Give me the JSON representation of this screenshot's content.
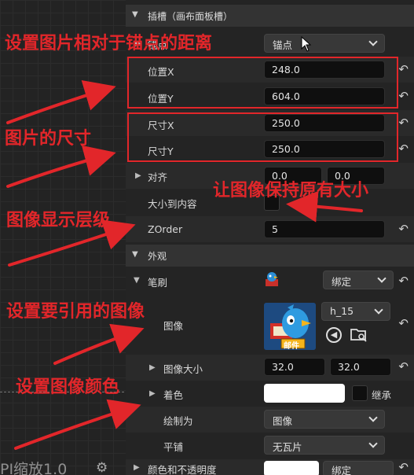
{
  "graph": {
    "bottom_text": "PI缩放1.0"
  },
  "slot": {
    "section_title": "插槽（画布面板槽）",
    "anchor_label": "锚点",
    "anchor_value": "锚点",
    "pos_x_label": "位置X",
    "pos_x_value": "248.0",
    "pos_y_label": "位置Y",
    "pos_y_value": "604.0",
    "size_x_label": "尺寸X",
    "size_x_value": "250.0",
    "size_y_label": "尺寸Y",
    "size_y_value": "250.0",
    "align_label": "对齐",
    "align_x": "0.0",
    "align_y": "0.0",
    "size_to_content_label": "大小到内容",
    "zorder_label": "ZOrder",
    "zorder_value": "5"
  },
  "appearance": {
    "section_title": "外观",
    "brush_label": "笔刷",
    "bind_label": "绑定",
    "image_label": "图像",
    "image_asset": "h_15",
    "thumb_badge": "邮件",
    "image_size_label": "图像大小",
    "image_size_x": "32.0",
    "image_size_y": "32.0",
    "tint_label": "着色",
    "inherit_label": "继承",
    "draw_as_label": "绘制为",
    "draw_as_value": "图像",
    "tiling_label": "平铺",
    "tiling_value": "无瓦片",
    "color_opacity_label": "颜色和不透明度",
    "bind_label_2": "绑定"
  },
  "annotations": {
    "a1": "设置图片相对于锚点的距离",
    "a2": "图片的尺寸",
    "a3": "让图像保持原有大小",
    "a4": "图像显示层级",
    "a5": "设置要引用的图像",
    "a6": "设置图像颜色"
  },
  "colors": {
    "annotation": "#e2262a",
    "panel_bg": "#242424",
    "field_bg": "#0f0f0f",
    "tint_swatch": "#ffffff"
  },
  "icons": [
    "reset-arrow-icon",
    "chevron-down-icon",
    "expand-arrow-icon",
    "browse-back-icon",
    "folder-search-icon",
    "settings-gear-icon",
    "mouse-cursor-icon"
  ]
}
